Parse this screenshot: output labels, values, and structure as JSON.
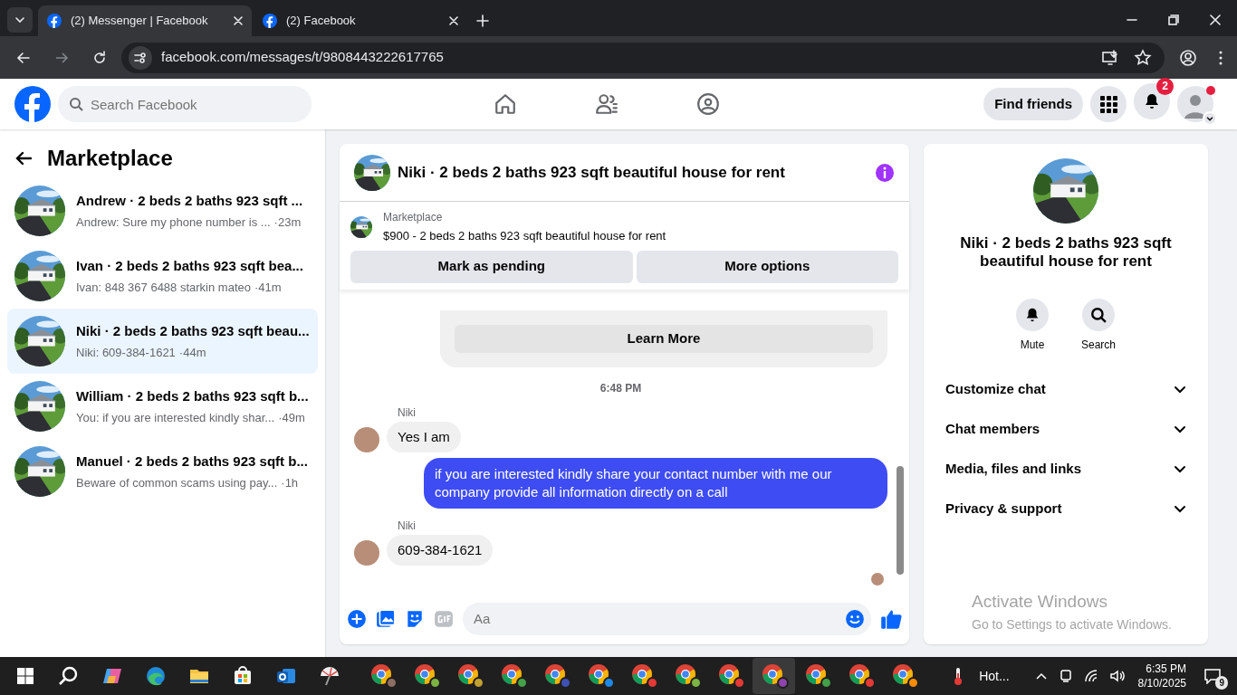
{
  "browser": {
    "tabs": [
      {
        "title": "(2) Messenger | Facebook",
        "selected": true
      },
      {
        "title": "(2) Facebook",
        "selected": false
      }
    ],
    "url": "facebook.com/messages/t/9808443222617765"
  },
  "header": {
    "search_placeholder": "Search Facebook",
    "find_friends": "Find friends",
    "notification_count": "2"
  },
  "sidebar": {
    "title": "Marketplace",
    "conversations": [
      {
        "title": "Andrew · 2 beds 2 baths 923 sqft ...",
        "preview": "Andrew: Sure my phone number is ...",
        "time": "·23m",
        "selected": false
      },
      {
        "title": "Ivan · 2 beds 2 baths 923 sqft bea...",
        "preview": "Ivan: 848 367 6488 starkin mateo",
        "time": "·41m",
        "selected": false
      },
      {
        "title": "Niki · 2 beds 2 baths 923 sqft beau...",
        "preview": "Niki: 609-384-1621",
        "time": "·44m",
        "selected": true
      },
      {
        "title": "William · 2 beds 2 baths 923 sqft b...",
        "preview": "You: if you are interested kindly shar...",
        "time": "·49m",
        "selected": false
      },
      {
        "title": "Manuel · 2 beds 2 baths 923 sqft b...",
        "preview": "Beware of common scams using pay...",
        "time": "·1h",
        "selected": false
      }
    ]
  },
  "chat": {
    "title": "Niki · 2 beds 2 baths 923 sqft beautiful house for rent",
    "listing": {
      "label": "Marketplace",
      "text": "$900 - 2 beds 2 baths 923 sqft beautiful house for rent"
    },
    "actions": [
      "Mark as pending",
      "More options"
    ],
    "messages": [
      {
        "kind": "notice",
        "button": "Learn More"
      },
      {
        "kind": "timestamp",
        "text": "6:48 PM"
      },
      {
        "kind": "incoming",
        "sender": "Niki",
        "text": "Yes I am"
      },
      {
        "kind": "outgoing",
        "text": "if you are interested kindly share your contact number with me our company provide all information directly on a call"
      },
      {
        "kind": "incoming",
        "sender": "Niki",
        "text": "609-384-1621"
      }
    ],
    "composer": {
      "placeholder": "Aa"
    }
  },
  "details": {
    "title": "Niki · 2 beds 2 baths 923 sqft beautiful house for rent",
    "actions": [
      {
        "kind": "mute",
        "label": "Mute"
      },
      {
        "kind": "search",
        "label": "Search"
      }
    ],
    "sections": [
      {
        "label": "Customize chat",
        "expanded": false
      },
      {
        "label": "Chat members",
        "expanded": false
      },
      {
        "label": "Media, files and links",
        "expanded": false
      },
      {
        "label": "Privacy & support",
        "expanded": false
      }
    ]
  },
  "watermark": {
    "title": "Activate Windows",
    "subtitle": "Go to Settings to activate Windows."
  },
  "taskbar": {
    "apps": [
      {
        "kind": "start",
        "selected": false
      },
      {
        "kind": "search",
        "selected": false
      },
      {
        "kind": "copilot",
        "selected": false
      },
      {
        "kind": "edge",
        "selected": false
      },
      {
        "kind": "explorer",
        "selected": false
      },
      {
        "kind": "store",
        "selected": false
      },
      {
        "kind": "outlook",
        "selected": false
      },
      {
        "kind": "snip",
        "selected": false
      },
      {
        "kind": "chrome",
        "color": "#8d6e63",
        "selected": false
      },
      {
        "kind": "chrome",
        "color": "#7cb342",
        "selected": false
      },
      {
        "kind": "chrome",
        "color": "#c0a030",
        "selected": false
      },
      {
        "kind": "chrome",
        "color": "#43a047",
        "selected": false
      },
      {
        "kind": "chrome",
        "color": "#3f51b5",
        "selected": false
      },
      {
        "kind": "chrome",
        "color": "#1e88e5",
        "selected": false
      },
      {
        "kind": "chrome",
        "color": "#e53935",
        "selected": false
      },
      {
        "kind": "chrome",
        "color": "#7cb342",
        "selected": false
      },
      {
        "kind": "chrome",
        "color": "#e53935",
        "selected": false
      },
      {
        "kind": "chrome",
        "color": "#8e44ad",
        "selected": true
      },
      {
        "kind": "chrome",
        "color": "#43a047",
        "selected": false
      },
      {
        "kind": "chrome",
        "color": "#e53935",
        "selected": false
      },
      {
        "kind": "chrome",
        "color": "#fb8c00",
        "selected": false
      }
    ],
    "weather": "Hot...",
    "time": "6:35 PM",
    "date": "8/10/2025",
    "notifications": "9"
  }
}
